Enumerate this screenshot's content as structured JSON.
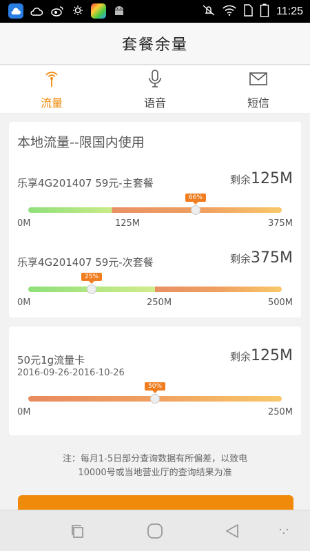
{
  "status_bar": {
    "time": "11:25",
    "notification_icons": [
      "cloud-app-icon",
      "weather-cloud-icon",
      "weibo-icon",
      "weather-sun-icon",
      "app-store-icon",
      "android-icon"
    ],
    "system_icons": [
      "mute-icon",
      "wifi-icon",
      "sim-icon",
      "battery-icon"
    ]
  },
  "header": {
    "title": "套餐余量"
  },
  "tabs": [
    {
      "label": "流量",
      "icon": "signal-icon",
      "active": true
    },
    {
      "label": "语音",
      "icon": "microphone-icon",
      "active": false
    },
    {
      "label": "短信",
      "icon": "envelope-icon",
      "active": false
    }
  ],
  "card1": {
    "title": "本地流量--限国内使用",
    "packages": [
      {
        "name": "乐享4G201407 59元-主套餐",
        "remain_label": "剩余",
        "remain_value": "125M",
        "percent": 66,
        "percent_label": "66%",
        "ticks": [
          "0M",
          "125M",
          "375M"
        ]
      },
      {
        "name": "乐享4G201407 59元-次套餐",
        "remain_label": "剩余",
        "remain_value": "375M",
        "percent": 25,
        "percent_label": "25%",
        "ticks": [
          "0M",
          "250M",
          "500M"
        ]
      }
    ]
  },
  "card2": {
    "package": {
      "name": "50元1g流量卡",
      "date_range": "2016-09-26-2016-10-26",
      "remain_label": "剩余",
      "remain_value": "125M",
      "percent": 50,
      "percent_label": "50%",
      "ticks": [
        "0M",
        "250M"
      ]
    }
  },
  "note": {
    "line1": "注：每月1-5日部分查询数据有所偏差，以致电",
    "line2": "10000号或当地营业厅的查询结果为准"
  },
  "colors": {
    "accent": "#f08a0b",
    "bar_green": "#8fe07a",
    "bar_orange": "#f0a060",
    "bar_end": "#f9c86a"
  },
  "nav_bar": [
    "recent-apps-icon",
    "home-icon",
    "back-icon",
    "more-icon"
  ]
}
